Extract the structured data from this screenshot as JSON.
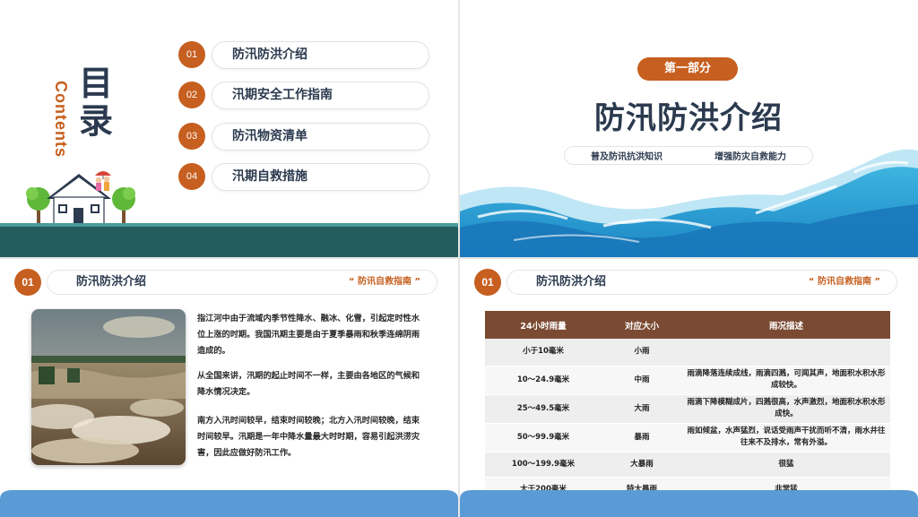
{
  "slide1": {
    "title": "目录",
    "title_en": "Contents",
    "items": [
      {
        "num": "01",
        "label": "防汛防洪介绍"
      },
      {
        "num": "02",
        "label": "汛期安全工作指南"
      },
      {
        "num": "03",
        "label": "防汛物资清单"
      },
      {
        "num": "04",
        "label": "汛期自救措施"
      }
    ]
  },
  "slide2": {
    "badge": "第一部分",
    "title": "防汛防洪介绍",
    "subtitles": [
      "普及防讯抗洪知识",
      "增强防灾自救能力"
    ]
  },
  "slide3": {
    "num": "01",
    "title": "防汛防洪介绍",
    "tag": "“ 防讯自救指南 ”",
    "paragraphs": [
      "指江河中由于流域内季节性降水、融冰、化雪，引起定时性水位上涨的时期。我国汛期主要是由于夏季暴雨和秋季连绵阴雨造成的。",
      "从全国来讲，汛期的起止时间不一样，主要由各地区的气候和降水情况决定。",
      "南方入汛时间较早，结束时间较晚；北方入汛时间较晚，结束时间较早。汛期是一年中降水量最大时时期，容易引起洪涝灾害，因此应做好防汛工作。"
    ]
  },
  "slide4": {
    "num": "01",
    "title": "防汛防洪介绍",
    "tag": "“ 防讯自救指南 ”",
    "headers": [
      "24小时雨量",
      "对应大小",
      "雨况描述"
    ],
    "rows": [
      [
        "小于10毫米",
        "小雨",
        ""
      ],
      [
        "10～24.9毫米",
        "中雨",
        "雨滴降落连续成线，雨滴四溅，可闻其声，地面积水积水形成较快。"
      ],
      [
        "25～49.5毫米",
        "大雨",
        "雨滴下降模糊成片，四溅很高，水声激烈，地面积水积水形成快。"
      ],
      [
        "50～99.9毫米",
        "暴雨",
        "雨如倾盆，水声猛烈，说话受雨声干扰而听不清，雨水井往往来不及排水，常有外溢。"
      ],
      [
        "100～199.9毫米",
        "大暴雨",
        "很猛"
      ],
      [
        "大于200毫米",
        "特大暴雨",
        "非常猛"
      ]
    ]
  },
  "colors": {
    "accent": "#c65f1f",
    "navy": "#2b3a4e",
    "teal_ground": "#235d5e",
    "wave_blue": "#2ea7d6",
    "bottom_blue": "#5b9bd5",
    "table_header": "#7a4a32"
  },
  "icons": [
    "house-illustration",
    "tree-illustration",
    "family-illustration",
    "wave-illustration",
    "flood-photo"
  ]
}
